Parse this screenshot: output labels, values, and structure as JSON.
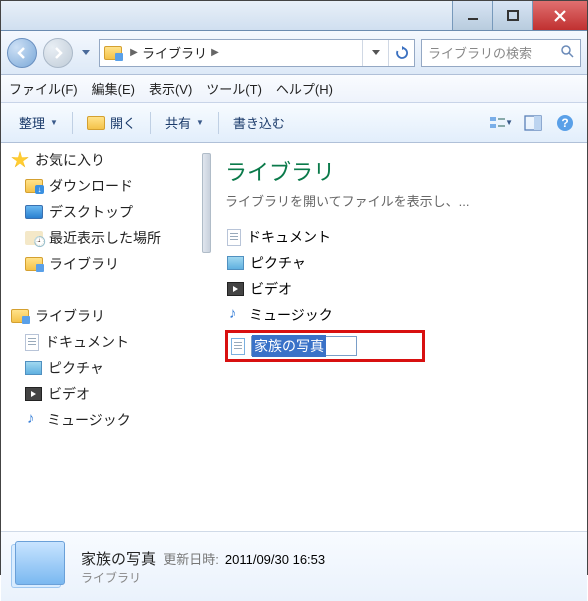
{
  "titlebar": {
    "minimize": "—",
    "maximize": "▭",
    "close": "X"
  },
  "nav": {
    "address_location": "ライブラリ",
    "search_placeholder": "ライブラリの検索"
  },
  "menubar": {
    "file": "ファイル(F)",
    "edit": "編集(E)",
    "view": "表示(V)",
    "tools": "ツール(T)",
    "help": "ヘルプ(H)"
  },
  "toolbar": {
    "organize": "整理",
    "open": "開く",
    "share": "共有",
    "burn": "書き込む"
  },
  "sidebar": {
    "favorites": {
      "label": "お気に入り",
      "items": [
        "ダウンロード",
        "デスクトップ",
        "最近表示した場所",
        "ライブラリ"
      ]
    },
    "libraries": {
      "label": "ライブラリ",
      "items": [
        "ドキュメント",
        "ピクチャ",
        "ビデオ",
        "ミュージック"
      ]
    }
  },
  "content": {
    "heading": "ライブラリ",
    "subtitle": "ライブラリを開いてファイルを表示し、...",
    "items": [
      "ドキュメント",
      "ピクチャ",
      "ビデオ",
      "ミュージック"
    ],
    "rename_value": "家族の写真"
  },
  "details": {
    "name": "家族の写真",
    "modified_label": "更新日時:",
    "modified_value": "2011/09/30 16:53",
    "type": "ライブラリ"
  }
}
